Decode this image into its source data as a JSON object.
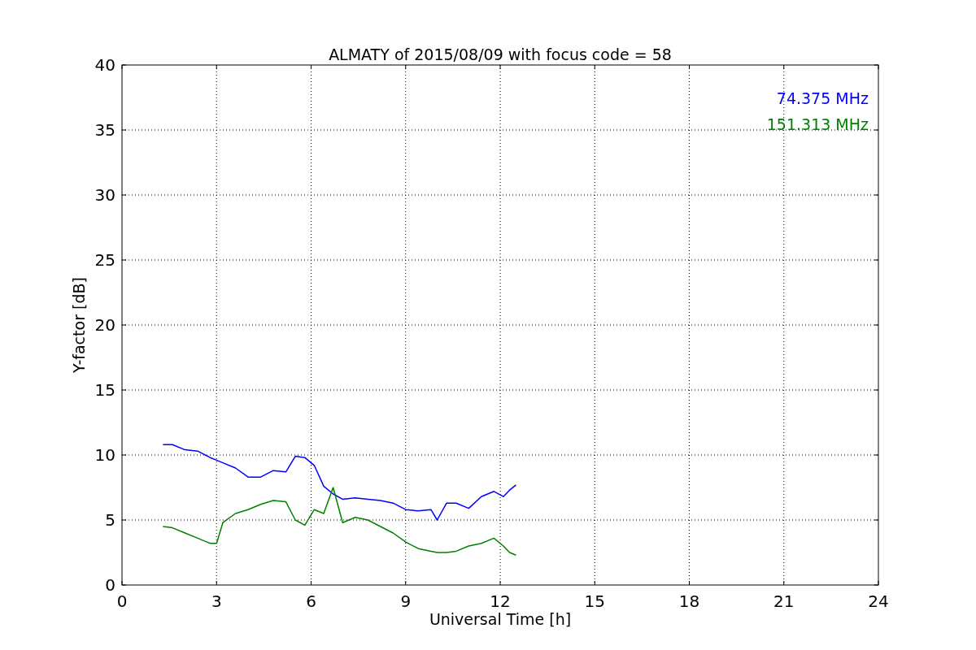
{
  "plot": {
    "chart_data": {
      "type": "line",
      "title": "ALMATY of 2015/08/09 with focus code = 58",
      "xlabel": "Universal Time [h]",
      "ylabel": "Y-factor [dB]",
      "x": [
        1.3,
        1.6,
        2,
        2.4,
        2.8,
        3.0,
        3.2,
        3.6,
        4,
        4.4,
        4.8,
        5.2,
        5.5,
        5.8,
        6.1,
        6.4,
        6.7,
        7.0,
        7.4,
        7.8,
        8.2,
        8.6,
        9,
        9.4,
        9.8,
        10,
        10.3,
        10.6,
        11,
        11.4,
        11.8,
        12.1,
        12.3,
        12.5
      ],
      "series": [
        {
          "name": "74.375 MHz",
          "color": "#0000ff",
          "values": [
            10.8,
            10.8,
            10.4,
            10.3,
            9.8,
            9.6,
            9.4,
            9.0,
            8.3,
            8.3,
            8.8,
            8.7,
            9.9,
            9.8,
            9.2,
            7.6,
            7.0,
            6.6,
            6.7,
            6.6,
            6.5,
            6.3,
            5.8,
            5.7,
            5.8,
            5.0,
            6.3,
            6.3,
            5.9,
            6.8,
            7.2,
            6.8,
            7.3,
            7.7
          ]
        },
        {
          "name": "151.313 MHz",
          "color": "#008000",
          "values": [
            4.5,
            4.4,
            4.0,
            3.6,
            3.2,
            3.2,
            4.8,
            5.5,
            5.8,
            6.2,
            6.5,
            6.4,
            5.0,
            4.6,
            5.8,
            5.5,
            7.5,
            4.8,
            5.2,
            5.0,
            4.5,
            4.0,
            3.3,
            2.8,
            2.6,
            2.5,
            2.5,
            2.6,
            3.0,
            3.2,
            3.6,
            3.0,
            2.5,
            2.3
          ]
        }
      ],
      "xlim": [
        0,
        24
      ],
      "ylim": [
        0,
        40
      ],
      "xticks": [
        0,
        3,
        6,
        9,
        12,
        15,
        18,
        21,
        24
      ],
      "yticks": [
        0,
        5,
        10,
        15,
        20,
        25,
        30,
        35,
        40
      ],
      "grid": true
    }
  }
}
